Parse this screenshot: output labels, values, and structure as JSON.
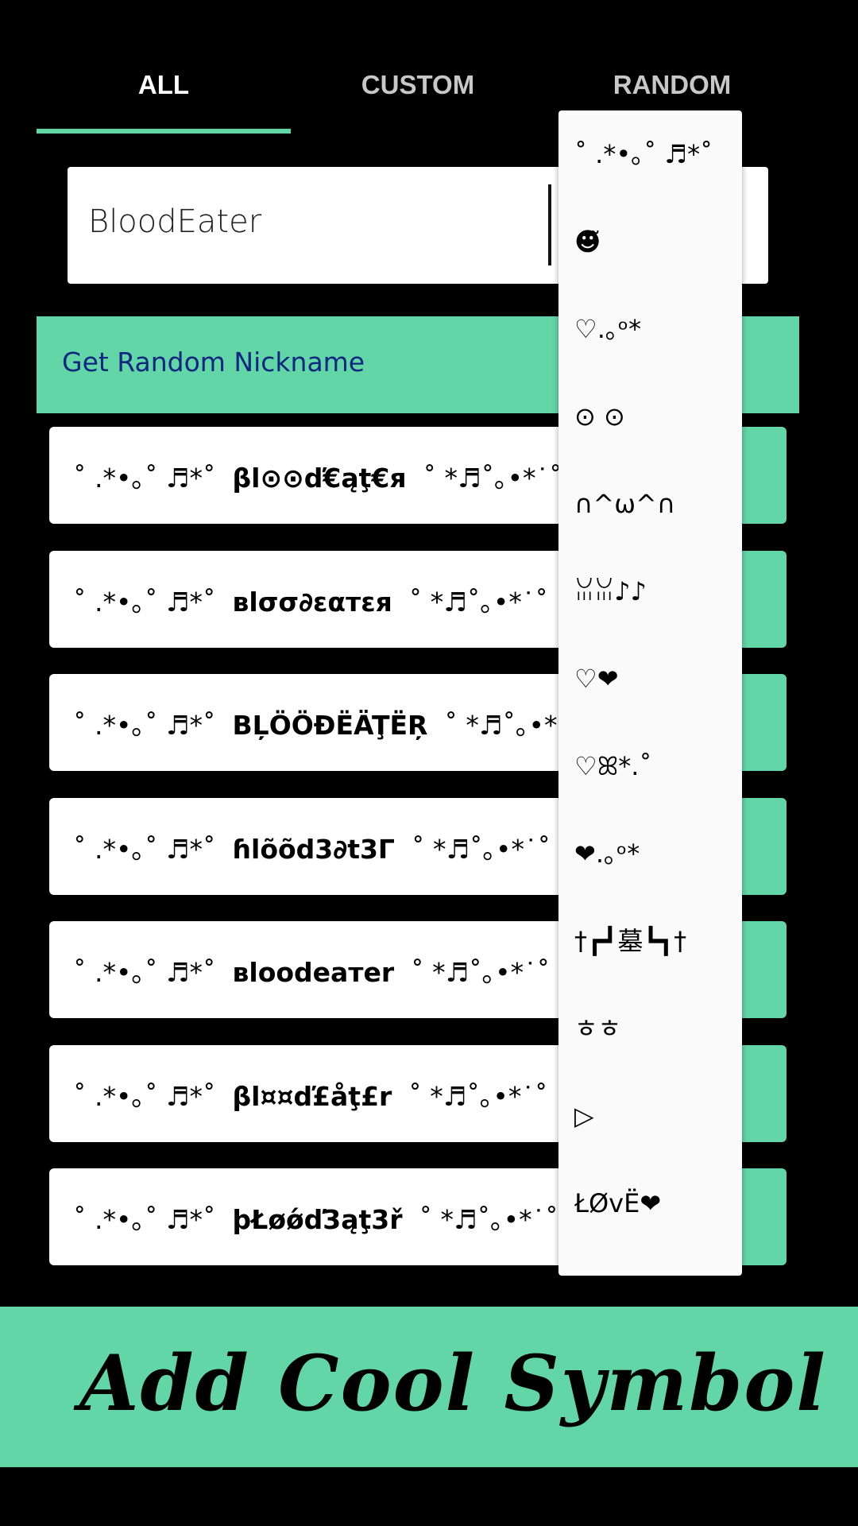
{
  "tabs": [
    {
      "label": "ALL",
      "active": true
    },
    {
      "label": "CUSTOM",
      "active": false
    },
    {
      "label": "RANDOM",
      "active": false
    }
  ],
  "input": {
    "value": "BloodEater"
  },
  "random_button": {
    "label": "Get Random Nickname"
  },
  "results": [
    {
      "prefix": "˚ .*•｡˚ ♬*˚",
      "name": "βl⊙⊙ď€ąţ€я",
      "suffix": "˚ *♬˚｡•*˙˚"
    },
    {
      "prefix": "˚ .*•｡˚ ♬*˚",
      "name": "вlσσ∂εαтεя",
      "suffix": "˚ *♬˚｡•*˙˚"
    },
    {
      "prefix": "˚ .*•｡˚ ♬*˚",
      "name": "BĻÖÖĐËÄŢËŖ",
      "suffix": "˚ *♬˚｡•*˙˚"
    },
    {
      "prefix": "˚ .*•｡˚ ♬*˚",
      "name": "ɦlõõd3∂t3Γ",
      "suffix": "˚ *♬˚｡•*˙˚"
    },
    {
      "prefix": "˚ .*•｡˚ ♬*˚",
      "name": "вloodeaтer",
      "suffix": "˚ *♬˚｡•*˙˚"
    },
    {
      "prefix": "˚ .*•｡˚ ♬*˚",
      "name": "βl¤¤ď£åţ£r",
      "suffix": "˚ *♬˚｡•*˙˚"
    },
    {
      "prefix": "˚ .*•｡˚ ♬*˚",
      "name": "þŁøǿď3ąţ3ř",
      "suffix": "˚ *♬˚｡•*˙˚"
    }
  ],
  "symbol_dropdown": [
    "˚ .*•｡˚ ♬*˚",
    "☻̃",
    "♡.｡ᵒ*",
    "⊙ ⊙",
    "∩^ω^∩",
    "ꈍꈍ♪♪",
    "♡❤",
    "♡ꕤ*.˚",
    "❤.｡ᵒ*",
    "†┏┛墓┗┓†",
    "ㅎㅎ",
    "▷",
    "ŁØvË❤"
  ],
  "banner": {
    "text": "Add Cool Symbol"
  },
  "colors": {
    "accent": "#62d6a6",
    "button_text": "#0d2680",
    "background": "#000000"
  }
}
